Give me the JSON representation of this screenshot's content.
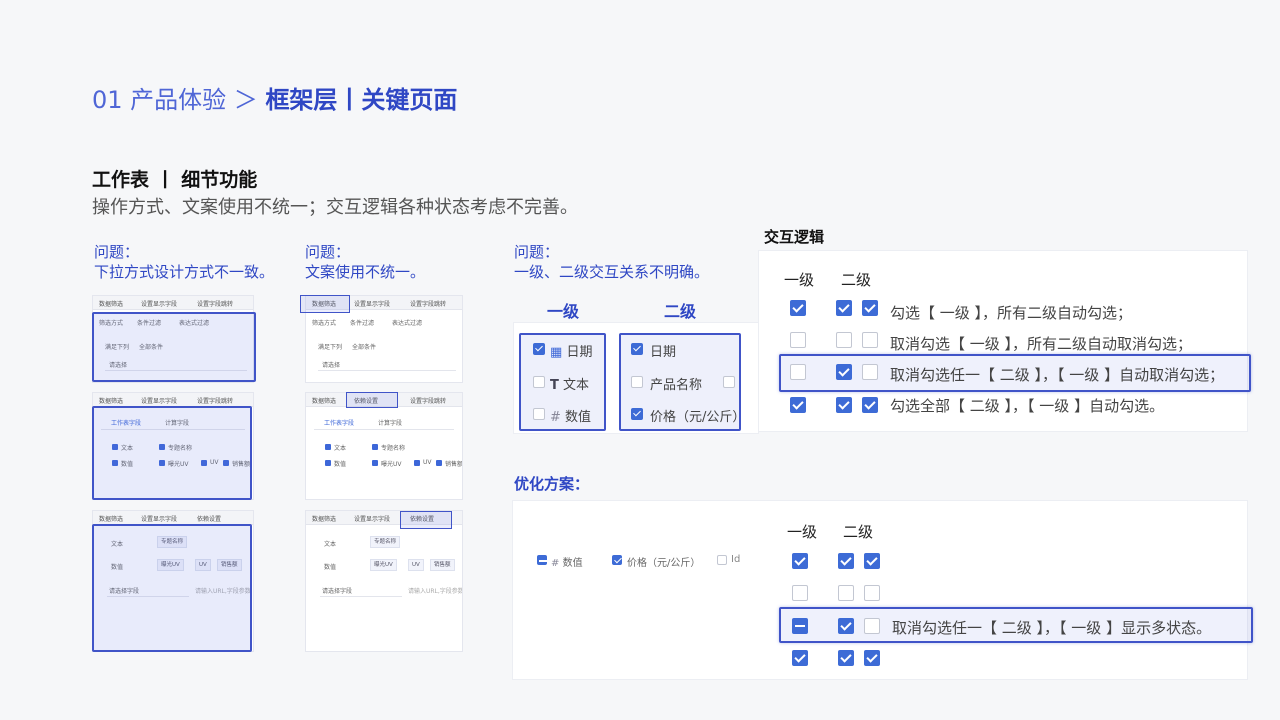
{
  "header": {
    "prefix": "01 产品体验 ＞ ",
    "title": "框架层丨关键页面"
  },
  "section": {
    "title": "工作表 丨 细节功能",
    "description": "操作方式、文案使用不统一；交互逻辑各种状态考虑不完善。"
  },
  "problems": [
    {
      "label": "问题：",
      "text": "下拉方式设计方式不一致。"
    },
    {
      "label": "问题：",
      "text": "文案使用不统一。"
    },
    {
      "label": "问题：",
      "text": "一级、二级交互关系不明确。"
    }
  ],
  "thumbs": {
    "tabs_a": [
      "数据筛选",
      "设置显示字段",
      "设置字段跳转"
    ],
    "tabs_b": [
      "数据筛选",
      "设置显示字段",
      "设置字段跳转"
    ],
    "tabs_c": [
      "数据筛选",
      "设置显示字段",
      "依赖设置"
    ],
    "filter_mode": "筛选方式",
    "cond_filter": "条件过滤",
    "expr_filter": "表达式过滤",
    "meet_below": "满足下列",
    "all_cond": "全部条件",
    "please_select": "请选择",
    "sheet_field": "工作表字段",
    "calc_field": "计算字段",
    "text": "文本",
    "special_name": "专题名称",
    "number": "数值",
    "exposure_uv": "曝光UV",
    "uv": "UV",
    "sales": "销售额",
    "select_field": "请选择字段",
    "input_url": "请输入URL,字段参数"
  },
  "levels": {
    "level1_title": "一级",
    "level2_title": "二级",
    "level1_items": [
      "日期",
      "文本",
      "数值"
    ],
    "level2_items": [
      "日期",
      "产品名称",
      "价格（元/公斤）"
    ]
  },
  "interaction": {
    "title": "交互逻辑",
    "col1": "一级",
    "col2": "二级",
    "rows": [
      "勾选【 一级 】，所有二级自动勾选；",
      "取消勾选【 一级 】，所有二级自动取消勾选；",
      "取消勾选任一【 二级 】，【 一级 】自动取消勾选；",
      "勾选全部【 二级 】，【 一级 】自动勾选。"
    ]
  },
  "optimize": {
    "title": "优化方案：",
    "col1": "一级",
    "col2": "二级",
    "demo_items": [
      "数值",
      "价格（元/公斤）",
      "Id"
    ],
    "highlight_text": "取消勾选任一【 二级 】，【 一级 】显示多状态。"
  },
  "colors": {
    "accent": "#2f47c4",
    "checkbox": "#3d6bd6",
    "highlight_border": "#4054c8"
  }
}
